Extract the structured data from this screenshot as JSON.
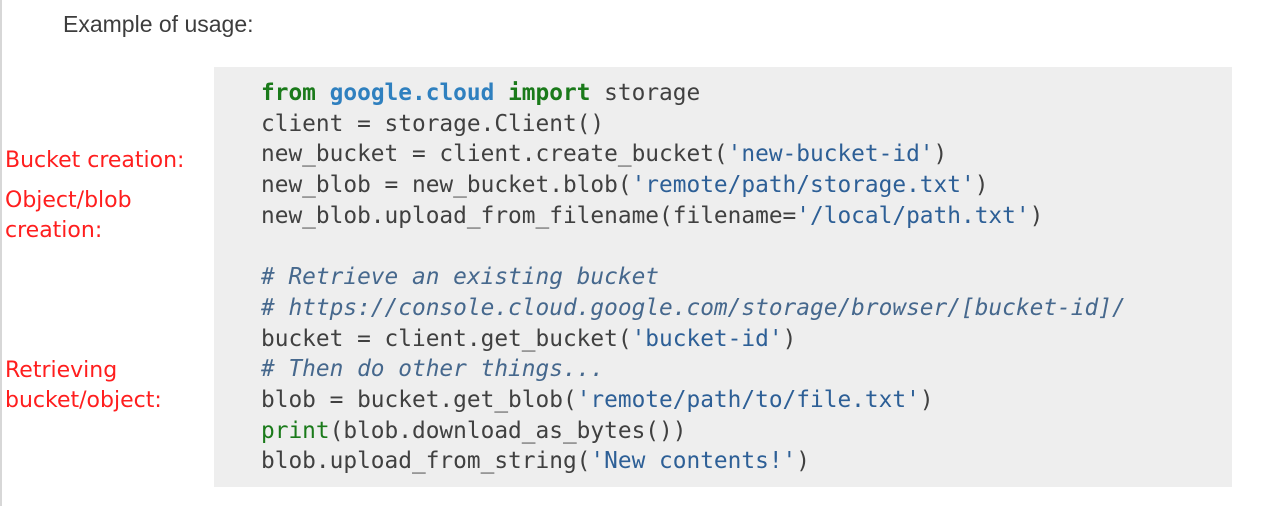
{
  "intro_text": "Example of usage:",
  "annotations": {
    "bucket_creation": "Bucket creation:",
    "object_creation": "Object/blob\ncreation:",
    "retrieving": "Retrieving\nbucket/object:"
  },
  "code": {
    "line1": {
      "kw_from": "from",
      "module": "google.cloud",
      "kw_import": "import",
      "rest": " storage"
    },
    "line2": "client = storage.Client()",
    "line3": {
      "prefix": "new_bucket = client.create_bucket(",
      "string": "'new-bucket-id'",
      "suffix": ")"
    },
    "line4": {
      "prefix": "new_blob = new_bucket.blob(",
      "string": "'remote/path/storage.txt'",
      "suffix": ")"
    },
    "line5": {
      "prefix": "new_blob.upload_from_filename(filename=",
      "string": "'/local/path.txt'",
      "suffix": ")"
    },
    "line7": "# Retrieve an existing bucket",
    "line8": "# https://console.cloud.google.com/storage/browser/[bucket-id]/",
    "line9": {
      "prefix": "bucket = client.get_bucket(",
      "string": "'bucket-id'",
      "suffix": ")"
    },
    "line10": "# Then do other things...",
    "line11": {
      "prefix": "blob = bucket.get_blob(",
      "string": "'remote/path/to/file.txt'",
      "suffix": ")"
    },
    "line12": {
      "builtin": "print",
      "rest": "(blob.download_as_bytes())"
    },
    "line13": {
      "prefix": "blob.upload_from_string(",
      "string": "'New contents!'",
      "suffix": ")"
    }
  },
  "colors": {
    "annotation": "#ff1e1e",
    "keyword": "#1a7a1a",
    "module": "#2f80bf",
    "string": "#2d5f96",
    "comment": "#46688d",
    "code_background": "#eeeeee"
  }
}
